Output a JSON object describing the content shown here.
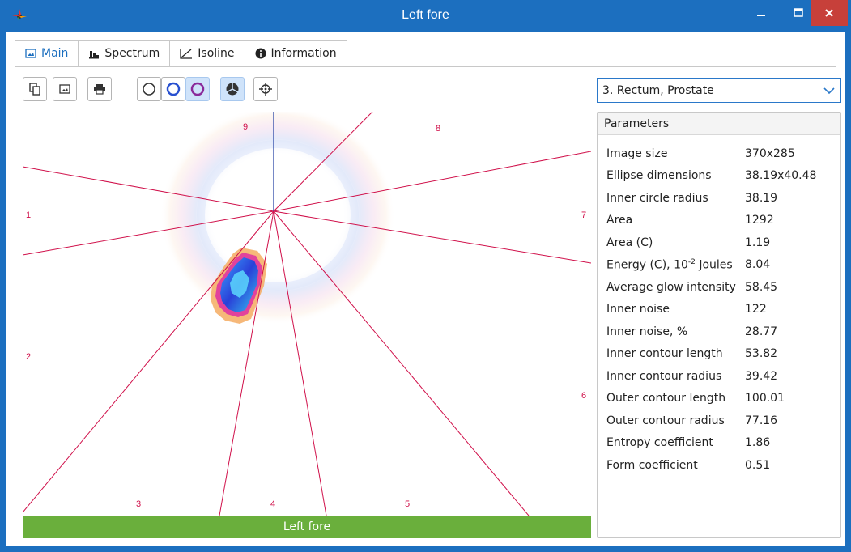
{
  "window": {
    "title": "Left fore",
    "icon": "app-logo-icon"
  },
  "tabs": [
    {
      "label": "Main",
      "icon": "image-icon",
      "active": true
    },
    {
      "label": "Spectrum",
      "icon": "bar-chart-icon",
      "active": false
    },
    {
      "label": "Isoline",
      "icon": "line-chart-icon",
      "active": false
    },
    {
      "label": "Information",
      "icon": "info-icon",
      "active": false
    }
  ],
  "toolbar": {
    "buttons": [
      {
        "icon": "copy-icon"
      },
      {
        "icon": "image-icon"
      },
      {
        "icon": "print-icon"
      },
      {
        "icon": "circle-outline-icon"
      },
      {
        "icon": "circle-blue-icon"
      },
      {
        "icon": "circle-purple-icon",
        "selected": true
      },
      {
        "icon": "sectors-icon",
        "selected": true
      },
      {
        "icon": "center-target-icon"
      }
    ]
  },
  "organ_select": {
    "value": "3. Rectum, Prostate"
  },
  "parameters": {
    "header": "Parameters",
    "rows": [
      {
        "name": "Image size",
        "value": "370x285"
      },
      {
        "name": "Ellipse dimensions",
        "value": "38.19x40.48"
      },
      {
        "name": "Inner circle radius",
        "value": "38.19"
      },
      {
        "name": "Area",
        "value": "1292"
      },
      {
        "name": "Area (C)",
        "value": "1.19"
      },
      {
        "name_prefix": "Energy (C), 10",
        "name_sup": "-2",
        "name_suffix": " Joules",
        "value": "8.04"
      },
      {
        "name": "Average glow intensity",
        "value": "58.45"
      },
      {
        "name": "Inner noise",
        "value": "122"
      },
      {
        "name": "Inner noise, %",
        "value": "28.77"
      },
      {
        "name": "Inner contour length",
        "value": "53.82"
      },
      {
        "name": "Inner contour radius",
        "value": "39.42"
      },
      {
        "name": "Outer contour length",
        "value": "100.01"
      },
      {
        "name": "Outer contour radius",
        "value": "77.16"
      },
      {
        "name": "Entropy coefficient",
        "value": "1.86"
      },
      {
        "name": "Form coefficient",
        "value": "0.51"
      }
    ]
  },
  "sectors": {
    "labels": [
      "9",
      "8",
      "1",
      "7",
      "2",
      "6",
      "3",
      "4",
      "5"
    ],
    "line_color": "#d0104a",
    "axis_color": "#1a3aa0"
  },
  "status": {
    "label": "Left fore",
    "color": "#6aaf3c"
  },
  "colors": {
    "accent": "#1c6fbf",
    "close": "#c7403a"
  }
}
